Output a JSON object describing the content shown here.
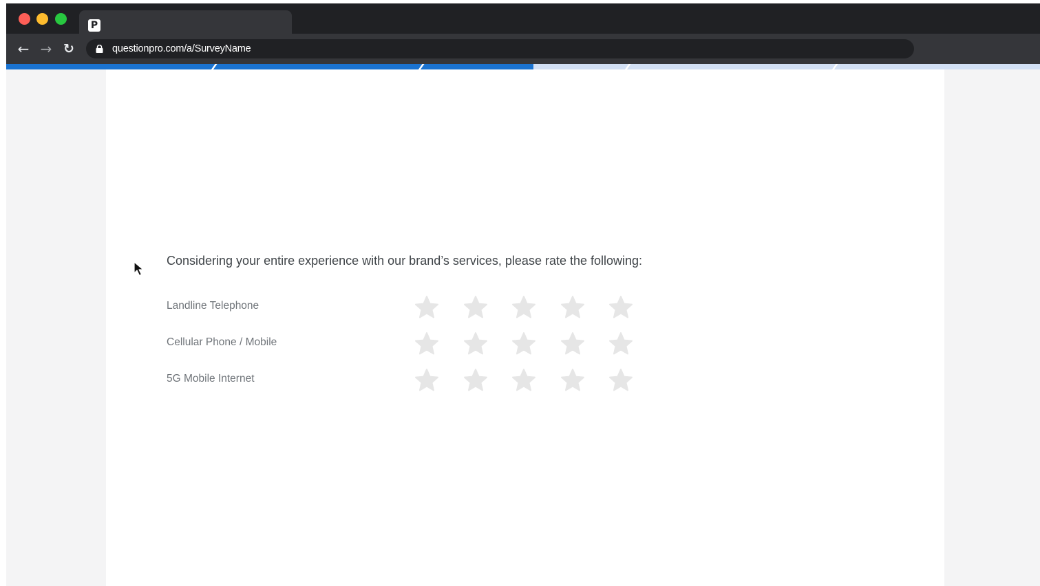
{
  "browser": {
    "favicon_glyph": "P",
    "url": "questionpro.com/a/SurveyName",
    "icons": {
      "back": "back-arrow-icon",
      "forward": "forward-arrow-icon",
      "reload": "reload-icon",
      "lock": "lock-icon"
    }
  },
  "survey": {
    "progress_fraction": 0.51,
    "progress_segments": 5,
    "question": "Considering your entire experience with our brand’s services, please rate the following:",
    "rows": [
      {
        "label": "Landline Telephone",
        "rating": 0
      },
      {
        "label": "Cellular Phone / Mobile",
        "rating": 0
      },
      {
        "label": "5G Mobile Internet",
        "rating": 0
      }
    ],
    "max_stars": 5
  },
  "colors": {
    "accent": "#1a73d1",
    "star_empty": "#e6e6e6",
    "star_filled": "#f5b301"
  }
}
